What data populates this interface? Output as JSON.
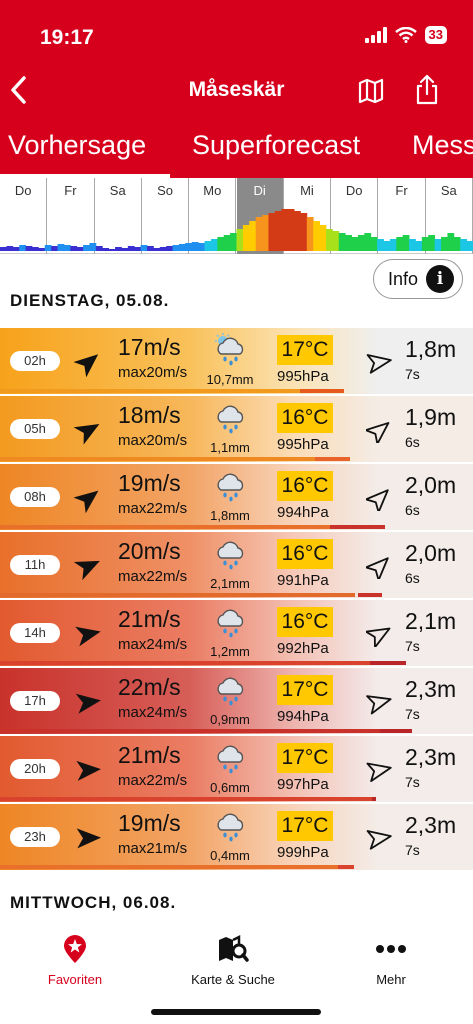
{
  "status_bar": {
    "time": "19:17",
    "battery": "33"
  },
  "header": {
    "title": "Måseskär"
  },
  "tabs": [
    {
      "label": "Vorhersage",
      "active": true
    },
    {
      "label": "Superforecast",
      "active": false
    },
    {
      "label": "Mess",
      "active": false
    }
  ],
  "overview": {
    "days": [
      "Do",
      "Fr",
      "Sa",
      "So",
      "Mo",
      "Di",
      "Mi",
      "Do",
      "Fr",
      "Sa"
    ],
    "active_day": "Di"
  },
  "info_button": {
    "label": "Info",
    "icon": "info-icon"
  },
  "sections": [
    {
      "date": "DIENSTAG, 05.08.",
      "rows": [
        {
          "hour": "02h",
          "speed": "17m/s",
          "gust": "max20m/s",
          "weather": "cloud-rain-sun",
          "precip": "10,7mm",
          "temp": "17°C",
          "pressure": "995hPa",
          "wave_h": "1,8m",
          "wave_p": "7s"
        },
        {
          "hour": "05h",
          "speed": "18m/s",
          "gust": "max20m/s",
          "weather": "cloud-rain",
          "precip": "1,1mm",
          "temp": "16°C",
          "pressure": "995hPa",
          "wave_h": "1,9m",
          "wave_p": "6s"
        },
        {
          "hour": "08h",
          "speed": "19m/s",
          "gust": "max22m/s",
          "weather": "cloud-rain",
          "precip": "1,8mm",
          "temp": "16°C",
          "pressure": "994hPa",
          "wave_h": "2,0m",
          "wave_p": "6s"
        },
        {
          "hour": "11h",
          "speed": "20m/s",
          "gust": "max22m/s",
          "weather": "cloud-rain",
          "precip": "2,1mm",
          "temp": "16°C",
          "pressure": "991hPa",
          "wave_h": "2,0m",
          "wave_p": "6s"
        },
        {
          "hour": "14h",
          "speed": "21m/s",
          "gust": "max24m/s",
          "weather": "cloud-rain",
          "precip": "1,2mm",
          "temp": "16°C",
          "pressure": "992hPa",
          "wave_h": "2,1m",
          "wave_p": "7s"
        },
        {
          "hour": "17h",
          "speed": "22m/s",
          "gust": "max24m/s",
          "weather": "cloud-rain",
          "precip": "0,9mm",
          "temp": "17°C",
          "pressure": "994hPa",
          "wave_h": "2,3m",
          "wave_p": "7s"
        },
        {
          "hour": "20h",
          "speed": "21m/s",
          "gust": "max22m/s",
          "weather": "cloud-rain",
          "precip": "0,6mm",
          "temp": "17°C",
          "pressure": "997hPa",
          "wave_h": "2,3m",
          "wave_p": "7s"
        },
        {
          "hour": "23h",
          "speed": "19m/s",
          "gust": "max21m/s",
          "weather": "cloud-rain",
          "precip": "0,4mm",
          "temp": "17°C",
          "pressure": "999hPa",
          "wave_h": "2,3m",
          "wave_p": "7s"
        }
      ]
    },
    {
      "date": "MITTWOCH, 06.08.",
      "rows": []
    }
  ],
  "tab_bar": [
    {
      "label": "Favoriten",
      "icon": "star-pin-icon",
      "active": true
    },
    {
      "label": "Karte & Suche",
      "icon": "map-search-icon",
      "active": false
    },
    {
      "label": "Mehr",
      "icon": "more-dots-icon",
      "active": false
    }
  ],
  "colors": {
    "brand": "#d6001c",
    "temp_badge": "#ffc800"
  }
}
